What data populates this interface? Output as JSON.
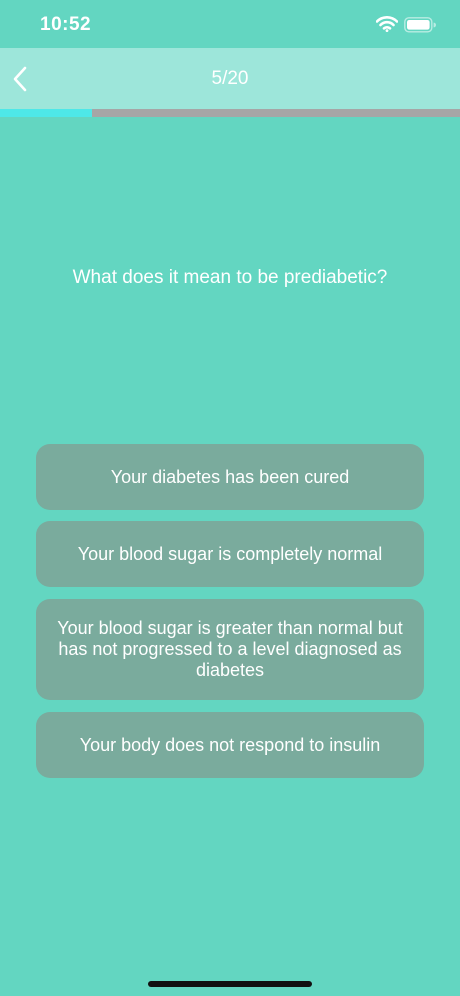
{
  "status_bar": {
    "time": "10:52",
    "icons": [
      "wifi-icon",
      "battery-icon"
    ]
  },
  "nav": {
    "back_icon": "chevron-left-icon",
    "title": "5/20"
  },
  "progress": {
    "current": 5,
    "total": 20,
    "fraction": 0.2
  },
  "question": {
    "text": "What does it mean to be prediabetic?"
  },
  "answers": [
    {
      "label": "Your diabetes has been cured"
    },
    {
      "label": "Your blood sugar is completely normal"
    },
    {
      "label": "Your blood sugar is greater than normal but has not progressed to a level diagnosed as diabetes"
    },
    {
      "label": "Your body does not respond to insulin"
    }
  ],
  "colors": {
    "background": "#63d6c1",
    "nav_bar": "#9de6da",
    "answer_button": "#7aab9d",
    "progress_fill": "#4ee8e8",
    "progress_track": "#a6a6a6",
    "text": "#ffffff"
  }
}
